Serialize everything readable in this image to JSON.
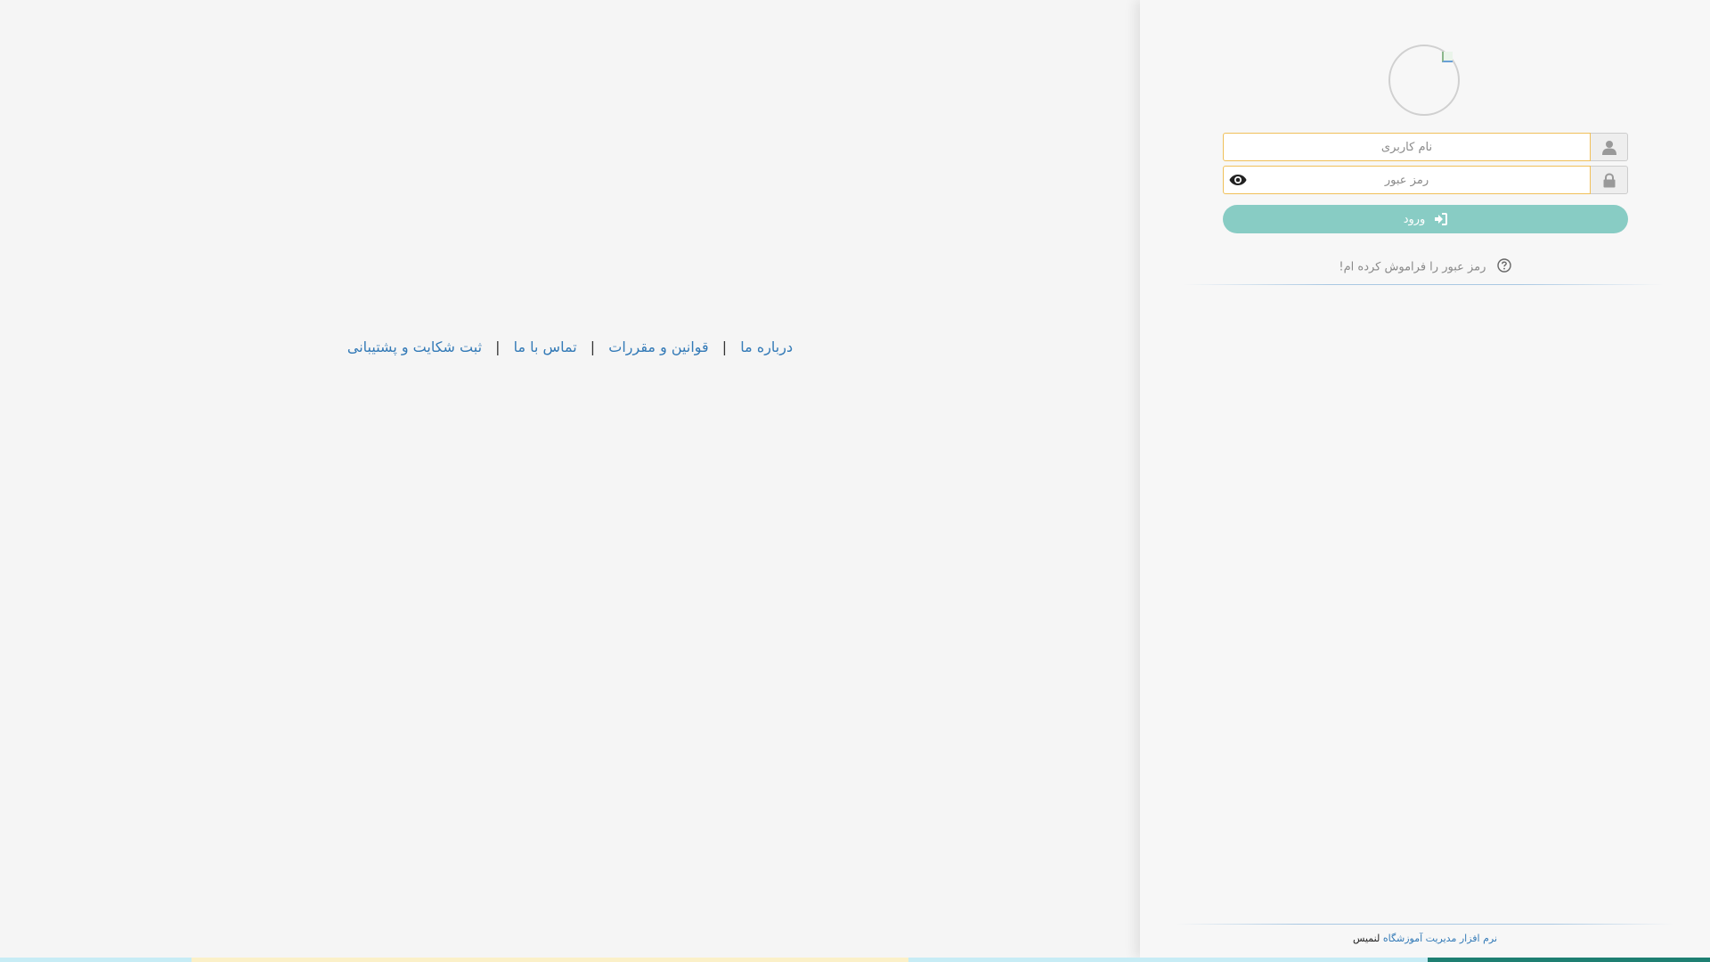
{
  "footer_links": {
    "about": "درباره ما",
    "rules": "قوانین و مقررات",
    "contact": "تماس با ما",
    "complaint": "ثبت شکایت و پشتیبانی",
    "separator": "|"
  },
  "login": {
    "username_placeholder": "نام کاربری",
    "password_placeholder": "رمز عبور",
    "submit_label": "ورود",
    "forgot_label": "رمز عبور را فراموش کرده ام!"
  },
  "credit": {
    "link_text": "نرم افزار مدیریت آموزشگاه",
    "brand": "لنمیس"
  },
  "icons": {
    "username": "user-icon",
    "password": "lock-icon",
    "show_password": "eye-icon",
    "submit": "sign-in-icon",
    "forgot": "question-circle-icon",
    "logo": "broken-image-icon"
  },
  "colors": {
    "link": "#337ab7",
    "login_button": "#88ccc4",
    "input_border": "#f0c05a",
    "bar_cyan": "#c7ecf5",
    "bar_yellow": "#fbf0c8",
    "bar_teal": "#1e7f72"
  }
}
